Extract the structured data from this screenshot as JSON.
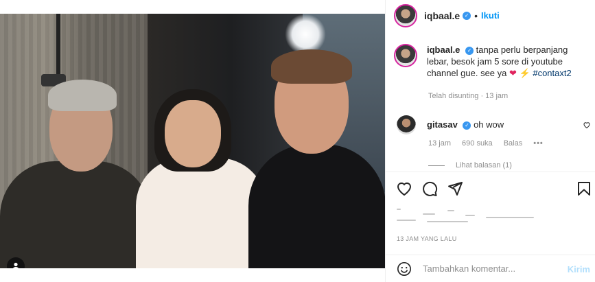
{
  "post": {
    "username": "iqbaal.e",
    "follow_label": "Ikuti",
    "separator": "•",
    "caption_text": "tanpa perlu berpanjang lebar, besok jam 5 sore di youtube channel gue. see ya",
    "caption_heart": "❤",
    "caption_bolt": "⚡",
    "caption_hashtag": "#contaxt2",
    "edited_label": "Telah disunting · 13 jam",
    "timestamp": "13 JAM YANG LALU"
  },
  "comment": {
    "username": "gitasav",
    "text": "oh wow",
    "time": "13 jam",
    "likes": "690 suka",
    "reply_label": "Balas",
    "more": "•••",
    "view_replies": "Lihat balasan (1)"
  },
  "composer": {
    "placeholder": "Tambahkan komentar...",
    "post_label": "Kirim"
  },
  "icons": {
    "verified": "verified-badge-icon",
    "tag": "user-tag-icon",
    "like": "heart-icon",
    "comment": "comment-icon",
    "share": "share-icon",
    "save": "bookmark-icon",
    "emoji": "emoji-icon"
  },
  "colors": {
    "accent": "#0095f6",
    "verified": "#3897f0",
    "muted": "#8e8e8e",
    "heart": "#e0245e"
  }
}
